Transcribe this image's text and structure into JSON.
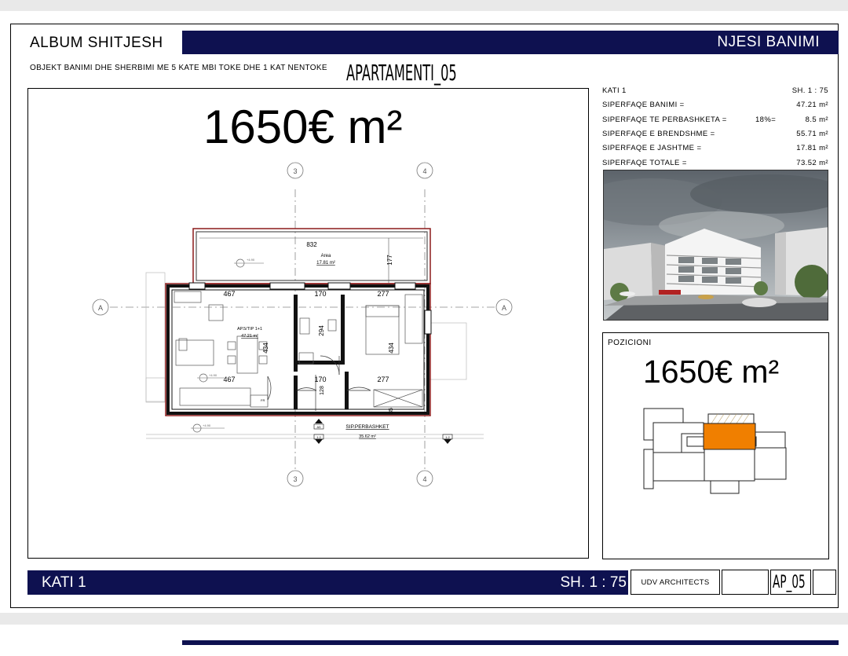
{
  "header": {
    "album": "ALBUM SHITJESH",
    "njesi": "NJESI BANIMI",
    "objekt": "OBJEKT BANIMI DHE SHERBIMI ME 5 KATE MBI TOKE DHE 1 KAT NENTOKE",
    "apartment": "APARTAMENTI_05"
  },
  "price": "1650€ m²",
  "plan": {
    "dims": {
      "d832": "832",
      "d177": "177",
      "d467a": "467",
      "d170a": "170",
      "d277a": "277",
      "d467b": "467",
      "d170b": "170",
      "d277b": "277",
      "d294": "294",
      "d434a": "434",
      "d434b": "434",
      "d128": "128",
      "d35": "35"
    },
    "area_label": "Area",
    "area_value": "17.81 m²",
    "ap_label": "AP.5/TIP 1+1",
    "ap_value": "47.21 m²",
    "sip_label": "SIP.PERBASHKET",
    "sip_value": "35.62 m²",
    "grid": {
      "g3": "3",
      "g4": "4",
      "gA": "A"
    },
    "levels": {
      "l1": "+4.90",
      "l2": "+4.90",
      "l3": "+4.90"
    },
    "door_tags": {
      "t1": "A5",
      "t2": "1.2",
      "t3": "1.2"
    }
  },
  "info": {
    "kati": "KATI 1",
    "sheet_scale": "SH. 1 : 75",
    "rows": [
      {
        "label": "SIPERFAQE BANIMI =",
        "pct": "",
        "value": "47.21 m²"
      },
      {
        "label": "SIPERFAQE TE PERBASHKETA =",
        "pct": "18%=",
        "value": "8.5 m²"
      },
      {
        "label": "SIPERFAQE E BRENDSHME =",
        "pct": "",
        "value": "55.71 m²"
      },
      {
        "label": "SIPERFAQE E JASHTME =",
        "pct": "",
        "value": "17.81 m²"
      },
      {
        "label": "SIPERFAQE TOTALE =",
        "pct": "",
        "value": "73.52 m²"
      }
    ]
  },
  "position": {
    "title": "POZICIONI",
    "price": "1650€ m²",
    "highlight_color": "#f07f00"
  },
  "footer": {
    "kati": "KATI 1",
    "scale": "SH. 1 : 75",
    "architect": "UDV ARCHITECTS",
    "code": "AP_05"
  },
  "colors": {
    "navy": "#0e1150",
    "wall_outline": "#8b1a1a"
  }
}
